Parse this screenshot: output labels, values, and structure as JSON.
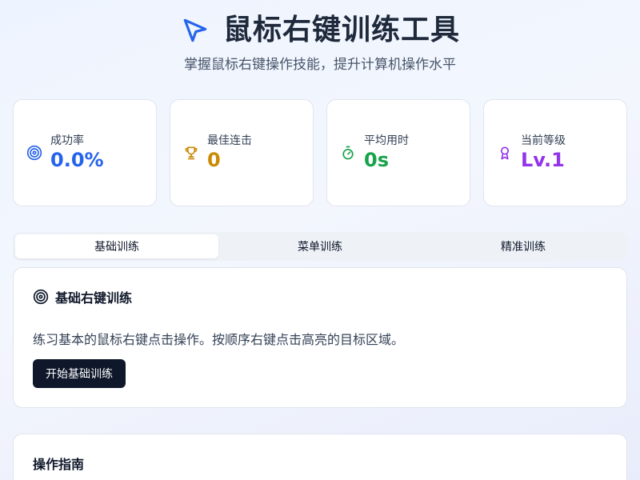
{
  "header": {
    "title": "鼠标右键训练工具",
    "subtitle": "掌握鼠标右键操作技能，提升计算机操作水平",
    "icon": "mouse-pointer-icon"
  },
  "stats": [
    {
      "label": "成功率",
      "value": "0.0%",
      "icon": "target-icon",
      "color": "#2563eb"
    },
    {
      "label": "最佳连击",
      "value": "0",
      "icon": "trophy-icon",
      "color": "#ca8a04"
    },
    {
      "label": "平均用时",
      "value": "0s",
      "icon": "timer-icon",
      "color": "#16a34a"
    },
    {
      "label": "当前等级",
      "value": "Lv.1",
      "icon": "award-icon",
      "color": "#9333ea"
    }
  ],
  "tabs": [
    {
      "label": "基础训练",
      "active": true
    },
    {
      "label": "菜单训练",
      "active": false
    },
    {
      "label": "精准训练",
      "active": false
    }
  ],
  "main_panel": {
    "title": "基础右键训练",
    "description": "练习基本的鼠标右键点击操作。按顺序右键点击高亮的目标区域。",
    "button_label": "开始基础训练"
  },
  "guide_panel": {
    "title": "操作指南"
  }
}
